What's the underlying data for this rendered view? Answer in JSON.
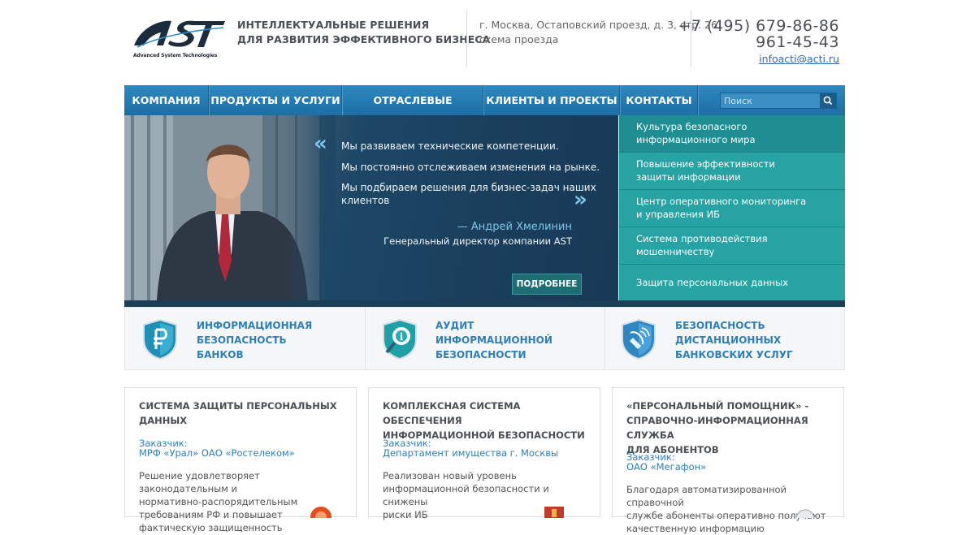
{
  "header": {
    "logo_text": "AST",
    "logo_subtitle": "Advanced System Technologies",
    "tagline_line1": "ИНТЕЛЛЕКТУАЛЬНЫЕ РЕШЕНИЯ",
    "tagline_line2": "ДЛЯ РАЗВИТИЯ ЭФФЕКТИВНОГО БИЗНЕСА",
    "address": "г. Москва, Остаповский проезд, д. 3, стр. 26",
    "map_link": "схема проезда",
    "phone1": "+7 (495) 679-86-86",
    "phone2": "961-45-43",
    "email": "infoacti@acti.ru"
  },
  "nav": {
    "items": [
      "КОМПАНИЯ",
      "ПРОДУКТЫ И УСЛУГИ",
      "ОТРАСЛЕВЫЕ РЕШЕНИЯ",
      "КЛИЕНТЫ И ПРОЕКТЫ",
      "КОНТАКТЫ"
    ],
    "search_placeholder": "Поиск"
  },
  "banner": {
    "quote_lines": [
      "Мы развиваем технические компетенции.",
      "Мы постоянно отслеживаем изменения на рынке.",
      "Мы подбираем решения для бизнес-задач наших",
      "клиентов"
    ],
    "author": "— Андрей Хмелинин",
    "role": "Генеральный директор компании AST",
    "more_button": "ПОДРОБНЕЕ"
  },
  "solutions": [
    {
      "line1": "Культура безопасного",
      "line2": "информационного мира"
    },
    {
      "line1": "Повышение эффективности",
      "line2": "защиты информации"
    },
    {
      "line1": "Центр оперативного мониторинга",
      "line2": "и управления ИБ"
    },
    {
      "line1": "Система противодействия",
      "line2": "мошенничеству"
    },
    {
      "line1": "Защита персональных данных",
      "line2": ""
    }
  ],
  "features": [
    {
      "lines": [
        "ИНФОРМАЦИОННАЯ",
        "БЕЗОПАСНОСТЬ",
        "БАНКОВ"
      ],
      "icon": "ruble-shield-icon"
    },
    {
      "lines": [
        "АУДИТ",
        "ИНФОРМАЦИОННОЙ",
        "БЕЗОПАСНОСТИ"
      ],
      "icon": "magnifier-shield-icon"
    },
    {
      "lines": [
        "БЕЗОПАСНОСТЬ",
        "ДИСТАНЦИОННЫХ",
        "БАНКОВСКИХ УСЛУГ"
      ],
      "icon": "satellite-shield-icon"
    }
  ],
  "projects": [
    {
      "title": [
        "СИСТЕМА ЗАЩИТЫ ПЕРСОНАЛЬНЫХ",
        "ДАННЫХ"
      ],
      "customer_label": "Заказчик:",
      "customer": "МРФ «Урал» ОАО «Ростелеком»",
      "desc": [
        "Решение удовлетворяет законодательным и",
        "нормативно-распорядительным",
        "требованиям РФ и повышает",
        "фактическую защищенность"
      ]
    },
    {
      "title": [
        "КОМПЛЕКСНАЯ СИСТЕМА ОБЕСПЕЧЕНИЯ",
        "ИНФОРМАЦИОННОЙ БЕЗОПАСНОСТИ"
      ],
      "customer_label": "Заказчик:",
      "customer": "Департамент имущества г. Москвы",
      "desc": [
        "Реализован новый уровень",
        "информационной безопасности и снижены",
        "риски ИБ"
      ]
    },
    {
      "title": [
        "«ПЕРСОНАЛЬНЫЙ ПОМОЩНИК» -",
        "СПРАВОЧНО-ИНФОРМАЦИОННАЯ СЛУЖБА",
        "ДЛЯ АБОНЕНТОВ"
      ],
      "customer_label": "Заказчик:",
      "customer": "ОАО «Мегафон»",
      "desc": [
        "Благодаря автоматизированной справочной",
        "службе абоненты оперативно получают",
        "качественную информацию"
      ]
    }
  ],
  "colors": {
    "nav_blue": "#1f74aa",
    "teal": "#27a3a3",
    "link_blue": "#2e7fb5"
  }
}
